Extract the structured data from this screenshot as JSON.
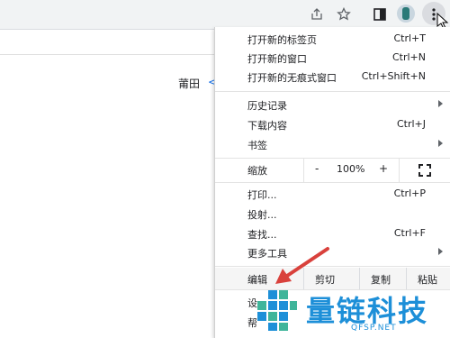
{
  "page": {
    "location_text": "莆田",
    "location_arrow": "<"
  },
  "menu": {
    "items": [
      {
        "label": "打开新的标签页",
        "shortcut": "Ctrl+T"
      },
      {
        "label": "打开新的窗口",
        "shortcut": "Ctrl+N"
      },
      {
        "label": "打开新的无痕式窗口",
        "shortcut": "Ctrl+Shift+N"
      },
      {
        "label": "历史记录",
        "submenu": true
      },
      {
        "label": "下载内容",
        "shortcut": "Ctrl+J"
      },
      {
        "label": "书签",
        "submenu": true
      },
      {
        "label": "打印...",
        "shortcut": "Ctrl+P"
      },
      {
        "label": "投射..."
      },
      {
        "label": "查找...",
        "shortcut": "Ctrl+F"
      },
      {
        "label": "更多工具",
        "submenu": true
      }
    ],
    "zoom": {
      "label": "缩放",
      "minus": "-",
      "value": "100%",
      "plus": "+"
    },
    "edit": {
      "label": "编辑",
      "cut": "剪切",
      "copy": "复制",
      "paste": "粘贴"
    },
    "partial_items": [
      "设",
      "帮"
    ]
  },
  "watermark": {
    "text": "量链科技",
    "sub": "QFSP.NET"
  },
  "colors": {
    "toolbar_bg": "#f1f3f4",
    "link_blue": "#1a73e8",
    "watermark_blue": "#1d8fd8",
    "arrow_red": "#d9413c"
  }
}
